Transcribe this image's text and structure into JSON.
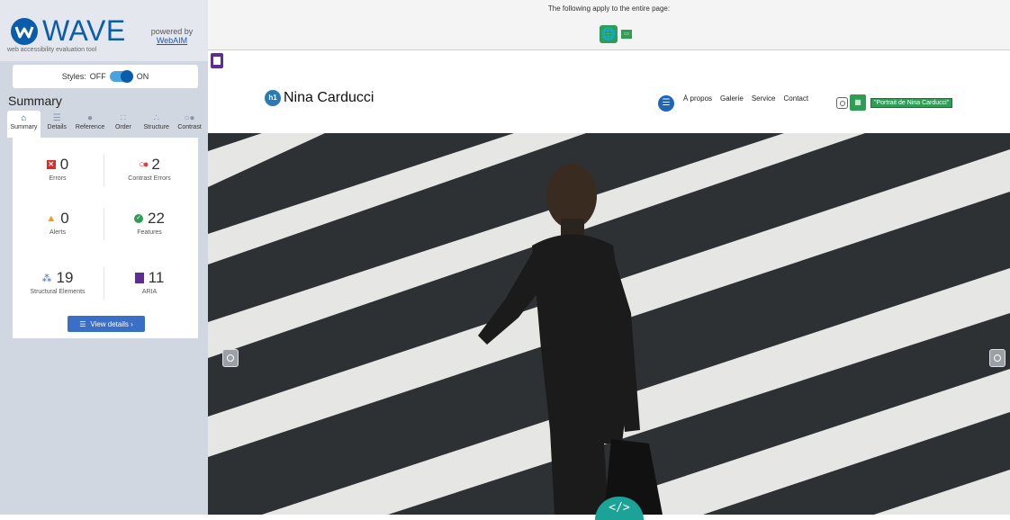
{
  "wave": {
    "logo_text": "WAVE",
    "tagline": "web accessibility evaluation tool",
    "powered_by": "powered by",
    "powered_link": "WebAIM",
    "styles_label": "Styles:",
    "styles_off": "OFF",
    "styles_on": "ON",
    "summary_title": "Summary",
    "tabs": [
      {
        "label": "Summary",
        "icon": "home-icon"
      },
      {
        "label": "Details",
        "icon": "list-icon"
      },
      {
        "label": "Reference",
        "icon": "info-icon"
      },
      {
        "label": "Order",
        "icon": "order-icon"
      },
      {
        "label": "Structure",
        "icon": "structure-icon"
      },
      {
        "label": "Contrast",
        "icon": "contrast-icon"
      }
    ],
    "stats": {
      "errors": {
        "value": "0",
        "label": "Errors"
      },
      "contrast_errors": {
        "value": "2",
        "label": "Contrast Errors"
      },
      "alerts": {
        "value": "0",
        "label": "Alerts"
      },
      "features": {
        "value": "22",
        "label": "Features"
      },
      "structural": {
        "value": "19",
        "label": "Structural Elements"
      },
      "aria": {
        "value": "11",
        "label": "ARIA"
      }
    },
    "view_details": "View details ›"
  },
  "page": {
    "notice": "The following apply to the entire page:",
    "site_name": "Nina Carducci",
    "nav": [
      "À propos",
      "Galerie",
      "Service",
      "Contact"
    ],
    "alt_text": "\"Portrait de Nina Carducci\""
  },
  "colors": {
    "wave_blue": "#0b5dab",
    "feature_green": "#2e9e54",
    "error_red": "#d32f2f",
    "aria_purple": "#5e2d91"
  }
}
